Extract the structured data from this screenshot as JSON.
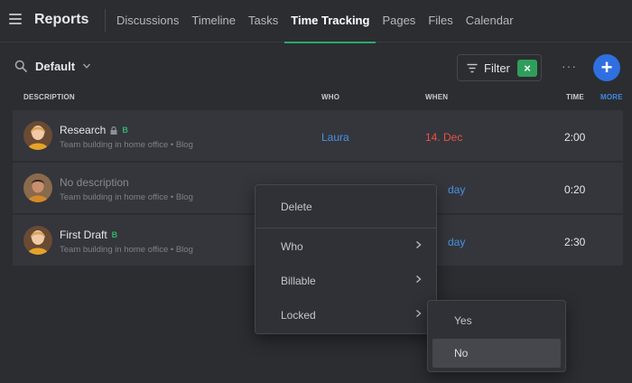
{
  "header": {
    "app_title": "Reports",
    "menu_icon": "hamburger-icon",
    "tabs": [
      {
        "label": "Discussions",
        "active": false
      },
      {
        "label": "Timeline",
        "active": false
      },
      {
        "label": "Tasks",
        "active": false
      },
      {
        "label": "Time Tracking",
        "active": true
      },
      {
        "label": "Pages",
        "active": false
      },
      {
        "label": "Files",
        "active": false
      },
      {
        "label": "Calendar",
        "active": false
      }
    ]
  },
  "toolbar": {
    "view_name": "Default",
    "filter_label": "Filter",
    "filter_clear": "×",
    "more": "···",
    "add": "+"
  },
  "columns": {
    "description": "DESCRIPTION",
    "who": "WHO",
    "when": "WHEN",
    "time": "TIME",
    "more": "MORE"
  },
  "rows": [
    {
      "title": "Research",
      "locked": true,
      "billable": "B",
      "subtitle": "Team building in home office • Blog",
      "who": "Laura",
      "when": "14. Dec",
      "time": "2:00"
    },
    {
      "title": "No description",
      "locked": false,
      "billable": "",
      "subtitle": "Team building in home office • Blog",
      "who": "",
      "when": "day",
      "time": "0:20"
    },
    {
      "title": "First Draft",
      "locked": false,
      "billable": "B",
      "subtitle": "Team building in home office • Blog",
      "who": "",
      "when": "day",
      "time": "2:30"
    }
  ],
  "context_menu": {
    "items": [
      {
        "label": "Delete"
      },
      {
        "label": "Who"
      },
      {
        "label": "Billable"
      },
      {
        "label": "Locked"
      }
    ]
  },
  "submenu": {
    "items": [
      {
        "label": "Yes"
      },
      {
        "label": "No"
      }
    ]
  },
  "colors": {
    "accent_green": "#2ea86a",
    "link_blue": "#4a90e2",
    "overdue_red": "#e8553e",
    "primary_blue": "#2f6fe0"
  }
}
